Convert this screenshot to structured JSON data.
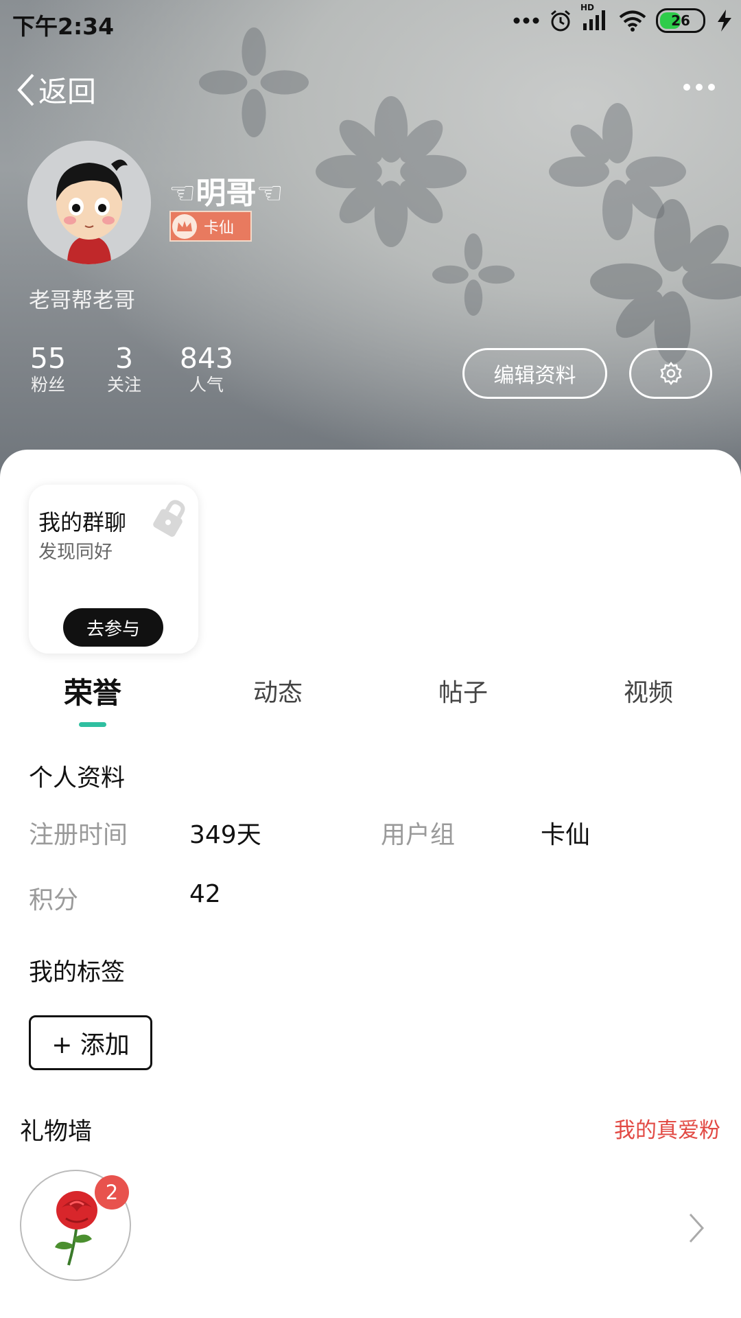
{
  "status_bar": {
    "time": "下午2:34",
    "battery": "26",
    "signal_label": "HD",
    "icons": [
      "more-dots-icon",
      "alarm-icon",
      "signal-icon",
      "wifi-icon",
      "battery-icon",
      "charging-icon"
    ]
  },
  "header": {
    "back_label": "返回",
    "more_icon": "more-icon"
  },
  "profile": {
    "name": "☜明哥☜",
    "badge": "卡仙",
    "bio": "老哥帮老哥",
    "stats": [
      {
        "value": "55",
        "label": "粉丝"
      },
      {
        "value": "3",
        "label": "关注"
      },
      {
        "value": "843",
        "label": "人气"
      }
    ],
    "edit_button": "编辑资料",
    "settings_icon": "gear-icon"
  },
  "group_card": {
    "title": "我的群聊",
    "subtitle": "发现同好",
    "button": "去参与",
    "icon": "lock-icon"
  },
  "tabs": [
    "荣誉",
    "动态",
    "帖子",
    "视频"
  ],
  "active_tab": "荣誉",
  "personal_info": {
    "title": "个人资料",
    "fields": [
      {
        "label": "注册时间",
        "value": "349天"
      },
      {
        "label": "用户组",
        "value": "卡仙"
      },
      {
        "label": "积分",
        "value": "42"
      }
    ]
  },
  "tags": {
    "title": "我的标签",
    "add_button": "+ 添加"
  },
  "gift_wall": {
    "title": "礼物墙",
    "fans_link": "我的真爱粉",
    "gift_count": "2",
    "gift_icon": "rose-icon"
  },
  "colors": {
    "accent": "#2fbfa0",
    "link_red": "#e24a44",
    "badge_orange": "#e87a5f"
  }
}
